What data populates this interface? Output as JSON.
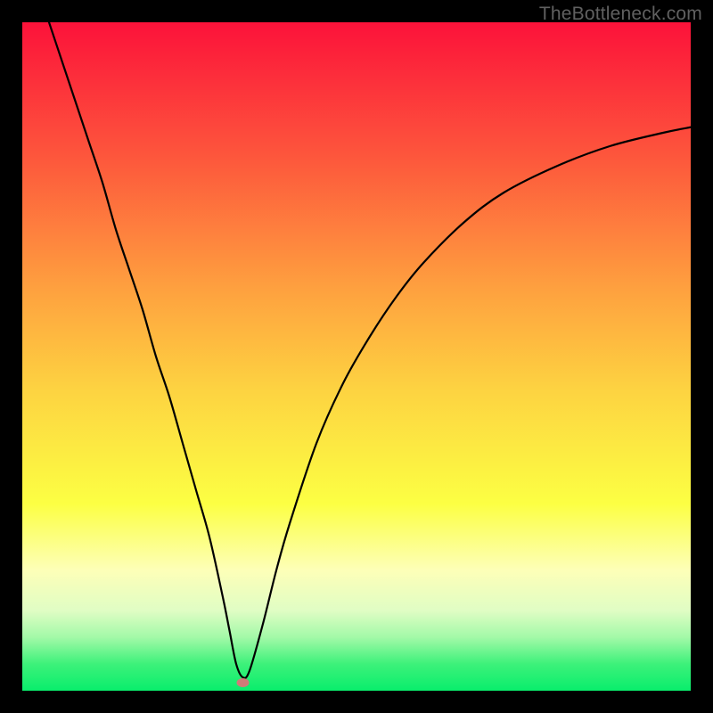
{
  "watermark": "TheBottleneck.com",
  "chart_data": {
    "type": "line",
    "title": "",
    "xlabel": "",
    "ylabel": "",
    "xlim": [
      0,
      100
    ],
    "ylim": [
      0,
      100
    ],
    "grid": false,
    "legend": false,
    "background_gradient": {
      "stops": [
        {
          "offset": 0.0,
          "color": "#fc123a"
        },
        {
          "offset": 0.2,
          "color": "#fd563c"
        },
        {
          "offset": 0.4,
          "color": "#fea13f"
        },
        {
          "offset": 0.55,
          "color": "#fdd341"
        },
        {
          "offset": 0.72,
          "color": "#fcff43"
        },
        {
          "offset": 0.82,
          "color": "#fdffb8"
        },
        {
          "offset": 0.88,
          "color": "#e0fdc4"
        },
        {
          "offset": 0.92,
          "color": "#a3f9a8"
        },
        {
          "offset": 0.96,
          "color": "#3df17a"
        },
        {
          "offset": 1.0,
          "color": "#09ee6c"
        }
      ]
    },
    "series": [
      {
        "name": "bottleneck-curve",
        "color": "#000000",
        "x": [
          4,
          6,
          8,
          10,
          12,
          14,
          16,
          18,
          20,
          22,
          24,
          26,
          28,
          30,
          31,
          32,
          33,
          34,
          36,
          38,
          40,
          44,
          48,
          52,
          56,
          60,
          66,
          72,
          80,
          88,
          96,
          100
        ],
        "y": [
          100,
          94,
          88,
          82,
          76,
          69,
          63,
          57,
          50,
          44,
          37,
          30,
          23,
          14,
          9,
          4,
          2,
          3,
          10,
          18,
          25,
          37,
          46,
          53,
          59,
          64,
          70,
          74.5,
          78.5,
          81.5,
          83.5,
          84.3
        ]
      }
    ],
    "marker": {
      "x": 33,
      "y": 1.2,
      "color": "#d17b78",
      "rx": 7,
      "ry": 5
    }
  }
}
